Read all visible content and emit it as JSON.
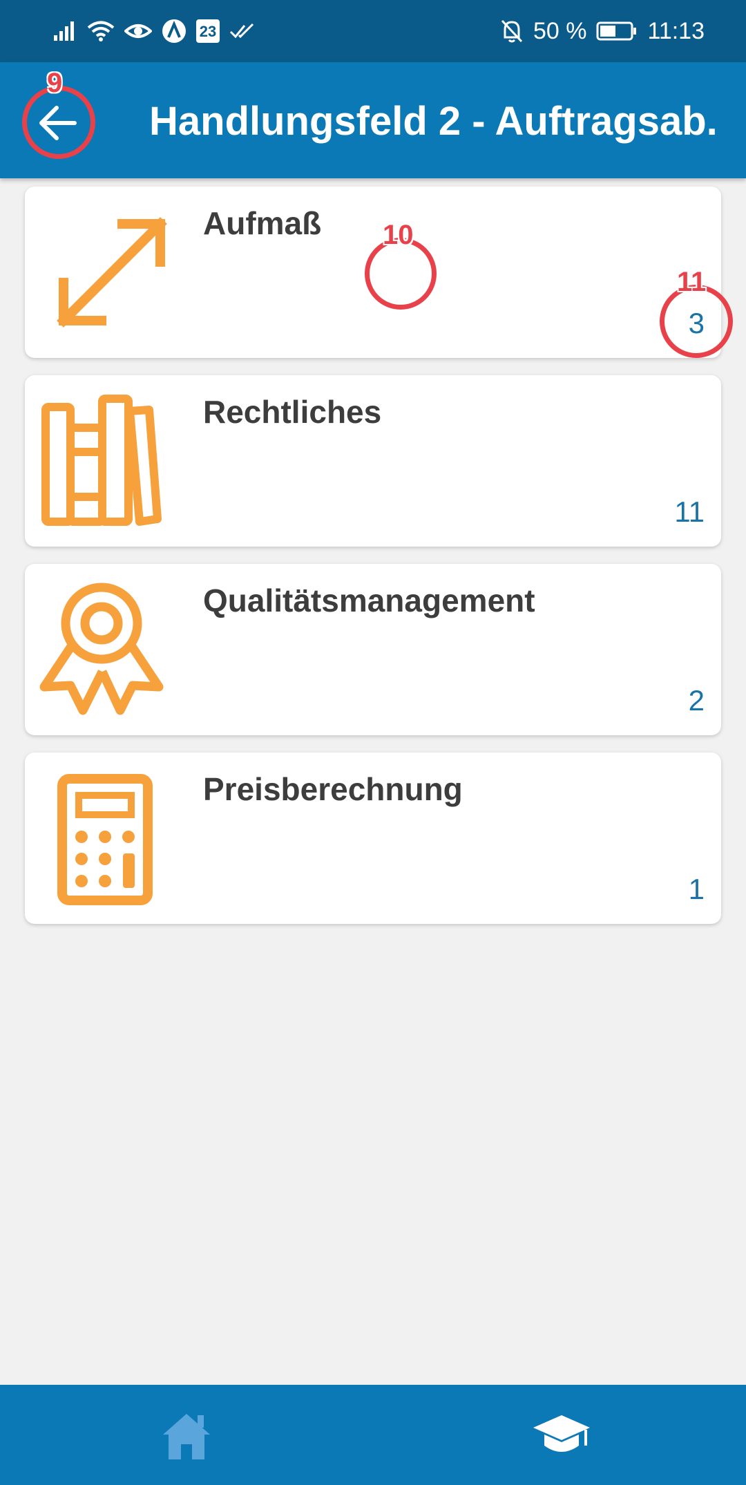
{
  "status_bar": {
    "calendar_day": "23",
    "battery": "50 %",
    "time": "11:13",
    "icons": [
      "signal-icon",
      "wifi-icon",
      "eye-icon",
      "a-circle-icon",
      "calendar-icon",
      "double-check-icon",
      "bell-off-icon",
      "battery-icon"
    ]
  },
  "app_bar": {
    "title": "Handlungsfeld 2 - Auftragsab..",
    "back_icon": "arrow-left-icon",
    "color": "#0a79b5"
  },
  "annotations": [
    {
      "label": "9"
    },
    {
      "label": "10"
    },
    {
      "label": "11"
    }
  ],
  "cards": [
    {
      "title": "Aufmaß",
      "count": "3",
      "icon": "diagonal-arrows-icon"
    },
    {
      "title": "Rechtliches",
      "count": "11",
      "icon": "books-icon"
    },
    {
      "title": "Qualitätsmanagement",
      "count": "2",
      "icon": "award-ribbon-icon"
    },
    {
      "title": "Preisberechnung",
      "count": "1",
      "icon": "calculator-icon"
    }
  ],
  "bottom_nav": {
    "items": [
      {
        "icon": "home-icon"
      },
      {
        "icon": "graduation-cap-icon"
      }
    ]
  },
  "colors": {
    "status_bar": "#0b5b8a",
    "accent_icon": "#f7a13d",
    "count_text": "#1a73a8",
    "annotation": "#e8414a"
  }
}
